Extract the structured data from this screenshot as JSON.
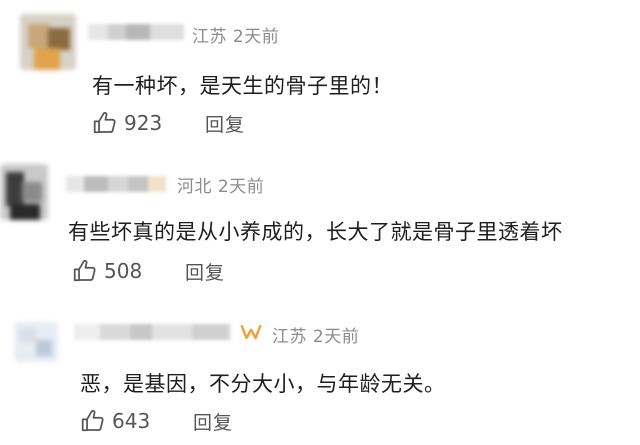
{
  "comments": [
    {
      "location": "江苏",
      "time": "2天前",
      "text": "有一种坏，是天生的骨子里的！",
      "likes": "923",
      "reply_label": "回复",
      "avatar_colors": [
        "#c9a77a",
        "#8a6a3e",
        "#e0a24d",
        "#d7d1c7"
      ]
    },
    {
      "location": "河北",
      "time": "2天前",
      "text": "有些坏真的是从小养成的，长大了就是骨子里透着坏",
      "likes": "508",
      "reply_label": "回复",
      "avatar_colors": [
        "#3d3d3d",
        "#8b8b8b",
        "#c9c9c9",
        "#2a2a2a"
      ]
    },
    {
      "location": "江苏",
      "time": "2天前",
      "text": "恶，是基因，不分大小，与年龄无关。",
      "likes": "643",
      "reply_label": "回复",
      "avatar_colors": [
        "#e8ecf3",
        "#d9dee8",
        "#bfc8d8",
        "#f2f4f8"
      ]
    }
  ],
  "colors": {
    "meta_text": "#8c8c8c",
    "body_text": "#1e1e1e",
    "action_text": "#555555",
    "vip_badge": "#f0a030"
  },
  "icons": {
    "like": "thumbs-up-icon",
    "badge": "vip-badge-icon"
  }
}
